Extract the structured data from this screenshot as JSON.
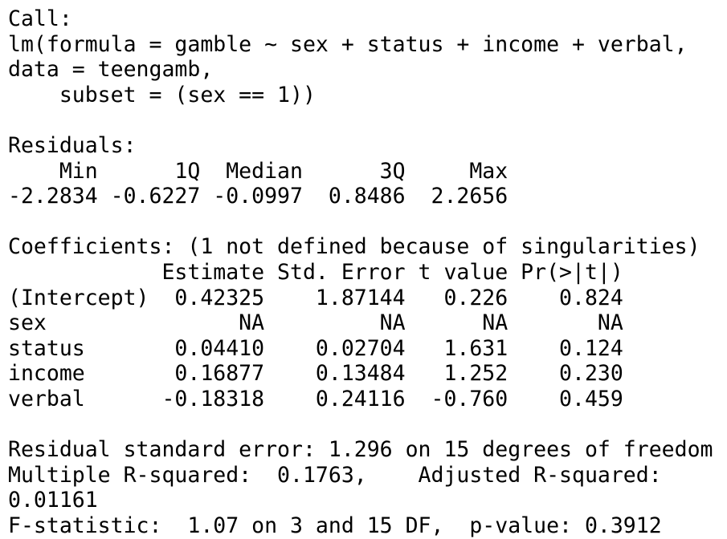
{
  "output": {
    "call_header": "Call:",
    "call_line1": "lm(formula = gamble ~ sex + status + income + verbal,",
    "call_line2": "data = teengamb,",
    "call_line3": "    subset = (sex == 1))",
    "residuals_header": "Residuals:",
    "residuals_labels": "    Min      1Q  Median      3Q     Max ",
    "residuals_values": "-2.2834 -0.6227 -0.0997  0.8486  2.2656 ",
    "coef_header": "Coefficients: (1 not defined because of singularities)",
    "coef_columns": "            Estimate Std. Error t value Pr(>|t|)",
    "coef_rows": [
      "(Intercept)  0.42325    1.87144   0.226    0.824",
      "sex               NA         NA      NA       NA",
      "status       0.04410    0.02704   1.631    0.124",
      "income       0.16877    0.13484   1.252    0.230",
      "verbal      -0.18318    0.24116  -0.760    0.459"
    ],
    "rse_line": "Residual standard error: 1.296 on 15 degrees of freedom",
    "rsq_line1": "Multiple R-squared:  0.1763,    Adjusted R-squared:  ",
    "rsq_line2": "0.01161",
    "fstat_line": "F-statistic:  1.07 on 3 and 15 DF,  p-value: 0.3912"
  }
}
